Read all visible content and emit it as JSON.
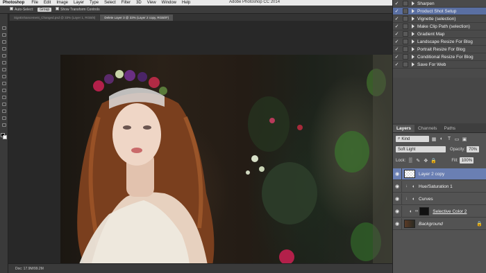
{
  "menubar": {
    "app": "Photoshop",
    "items": [
      "File",
      "Edit",
      "Image",
      "Layer",
      "Type",
      "Select",
      "Filter",
      "3D",
      "View",
      "Window",
      "Help"
    ],
    "window_title": "Adobe Photoshop CC 2014"
  },
  "options": {
    "auto_select_label": "Auto-Select:",
    "auto_select_value": "Group",
    "show_transform": "Show Transform Controls"
  },
  "doc_tabs": [
    "SignEnhancement_Changed.psd @ 33% (Layer 1, RGB/8)",
    "Delete Layer 3 @ 33% (Layer 2 copy, RGB/8*)"
  ],
  "status": {
    "doc_info": "Doc: 17.9M/99.2M"
  },
  "actions": {
    "items": [
      {
        "label": "Sharpen",
        "checked": true,
        "selected": false
      },
      {
        "label": "Product Shot Setup",
        "checked": true,
        "selected": true
      },
      {
        "label": "Vignette (selection)",
        "checked": true,
        "selected": false
      },
      {
        "label": "Make Clip Path (selection)",
        "checked": true,
        "selected": false
      },
      {
        "label": "Gradient Map",
        "checked": true,
        "selected": false
      },
      {
        "label": "Landscape Resize For Blog",
        "checked": true,
        "selected": false
      },
      {
        "label": "Portrait Resize For Blog",
        "checked": true,
        "selected": false
      },
      {
        "label": "Conditional Resize For Blog",
        "checked": true,
        "selected": false
      },
      {
        "label": "Save For Web",
        "checked": true,
        "selected": false
      }
    ]
  },
  "layers_panel": {
    "tabs": [
      "Layers",
      "Channels",
      "Paths"
    ],
    "filter": "Kind",
    "blend_mode": "Soft Light",
    "opacity_label": "Opacity:",
    "opacity_value": "70%",
    "lock_label": "Lock:",
    "fill_label": "Fill:",
    "fill_value": "100%",
    "layers": [
      {
        "name": "Layer 2 copy",
        "selected": true,
        "italic": false
      },
      {
        "name": "Hue/Saturation 1",
        "selected": false,
        "italic": false
      },
      {
        "name": "Curves",
        "selected": false,
        "italic": false
      },
      {
        "name": "Selective Color 2",
        "selected": false,
        "italic": false
      },
      {
        "name": "Background",
        "selected": false,
        "italic": true
      }
    ]
  },
  "colors": {
    "selection": "#6a7fb3",
    "action_selection": "#5a6fa2",
    "panel_bg": "#535353"
  }
}
